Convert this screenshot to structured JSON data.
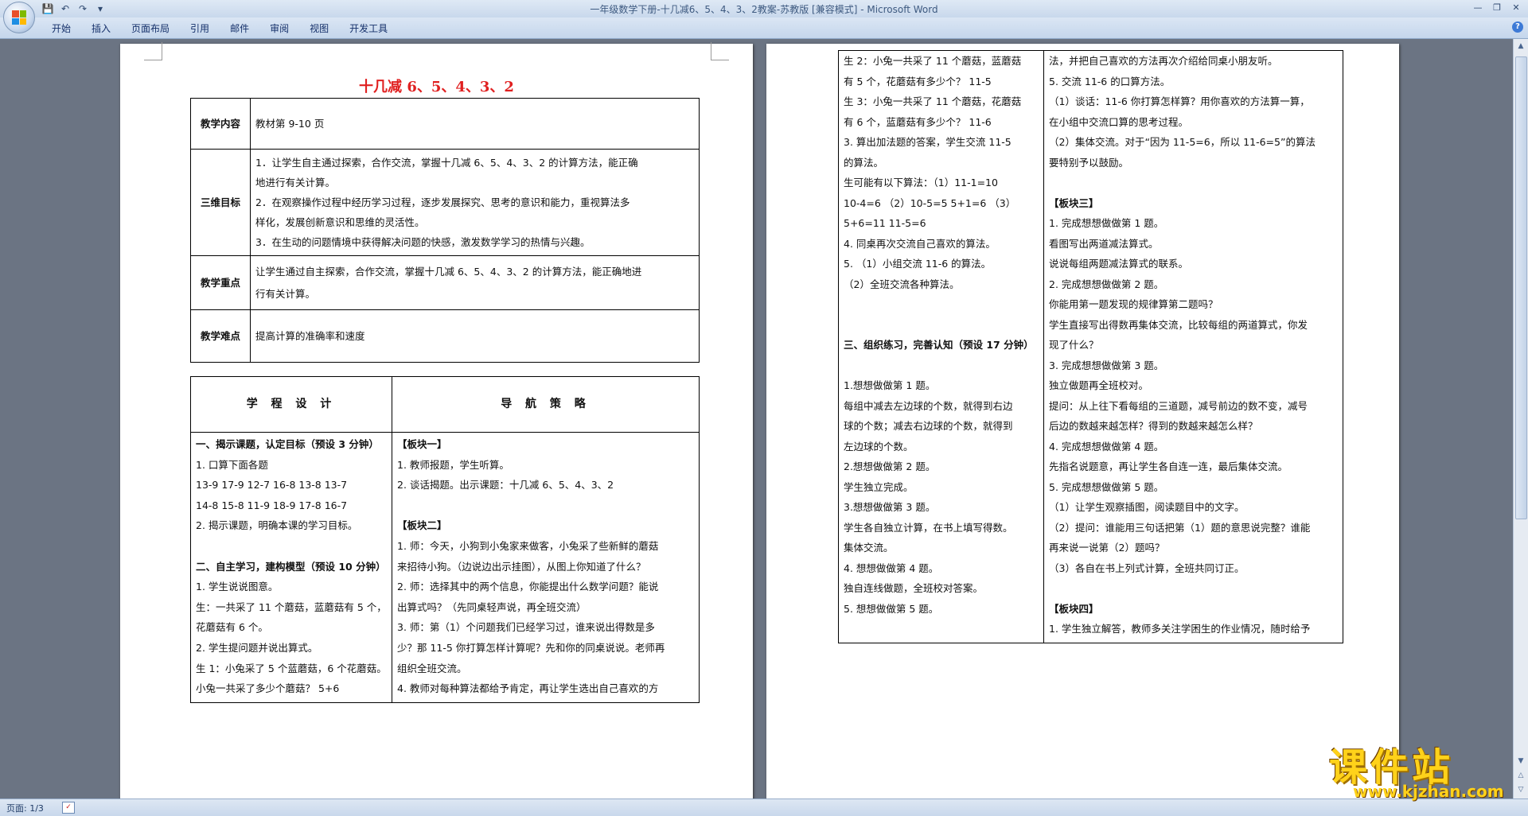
{
  "window": {
    "title": "一年级数学下册-十几减6、5、4、3、2教案-苏教版 [兼容模式] - Microsoft Word"
  },
  "ribbon_tabs": [
    "开始",
    "插入",
    "页面布局",
    "引用",
    "邮件",
    "审阅",
    "视图",
    "开发工具"
  ],
  "status": {
    "page": "页面: 1/3"
  },
  "logo": {
    "text": "课件站",
    "url": "www.kjzhan.com"
  },
  "page1": {
    "title": "十几减 6、5、4、3、2",
    "rows": [
      {
        "label": "教学内容",
        "content": [
          "教材第 9-10 页"
        ]
      },
      {
        "label": "三维目标",
        "content": [
          "1．让学生自主通过探索，合作交流，掌握十几减 6、5、4、3、2 的计算方法，能正确",
          "地进行有关计算。",
          "2．在观察操作过程中经历学习过程，逐步发展探究、思考的意识和能力，重视算法多",
          "样化，发展创新意识和思维的灵活性。",
          "3．在生动的问题情境中获得解决问题的快感，激发数学学习的热情与兴趣。"
        ]
      },
      {
        "label": "教学重点",
        "content": [
          "让学生通过自主探索，合作交流，掌握十几减 6、5、4、3、2 的计算方法，能正确地进",
          "行有关计算。"
        ]
      },
      {
        "label": "教学难点",
        "content": [
          "提高计算的准确率和速度"
        ]
      }
    ],
    "col_heads": [
      "学 程 设 计",
      "导 航 策 略"
    ],
    "left_lines": [
      "一、揭示课题，认定目标（预设 3 分钟）",
      "1. 口算下面各题",
      "13-9  17-9  12-7  16-8  13-8  13-7",
      "14-8  15-8  11-9  18-9  17-8  16-7",
      "2. 揭示课题，明确本课的学习目标。",
      "",
      "二、自主学习，建构模型（预设 10 分钟）",
      "1. 学生说说图意。",
      "生：一共采了 11 个蘑菇，蓝蘑菇有 5 个，",
      "花蘑菇有 6 个。",
      "2. 学生提问题并说出算式。",
      "生 1：小兔采了 5 个蓝蘑菇，6 个花蘑菇。",
      "小兔一共采了多少个蘑菇？  5+6"
    ],
    "right_lines": [
      "【板块一】",
      "1. 教师报题，学生听算。",
      "2. 谈话揭题。出示课题：十几减 6、5、4、3、2",
      "",
      "【板块二】",
      "1. 师：今天，小狗到小兔家来做客，小兔采了些新鲜的蘑菇",
      "来招待小狗。（边说边出示挂图），从图上你知道了什么？",
      "2. 师：选择其中的两个信息，你能提出什么数学问题？能说",
      "出算式吗？（先同桌轻声说，再全班交流）",
      "3. 师：第（1）个问题我们已经学习过，谁来说出得数是多",
      "少？那 11-5 你打算怎样计算呢？先和你的同桌说说。老师再",
      "组织全班交流。",
      "4. 教师对每种算法都给予肯定，再让学生选出自己喜欢的方"
    ]
  },
  "page2": {
    "left_lines": [
      "生 2：小兔一共采了 11 个蘑菇，蓝蘑菇",
      "有 5 个，花蘑菇有多少个？    11-5",
      "生 3：小兔一共采了 11 个蘑菇，花蘑菇",
      "有 6 个，蓝蘑菇有多少个？    11-6",
      "3. 算出加法题的答案，学生交流 11-5",
      "的算法。",
      "生可能有以下算法：（1）11-1=10",
      "10-4=6  （2）10-5=5  5+1=6   （3）",
      "5+6=11   11-5=6",
      "4. 同桌再次交流自己喜欢的算法。",
      "5. （1）小组交流 11-6 的算法。",
      "   （2）全班交流各种算法。",
      "",
      "",
      "三、组织练习，完善认知（预设 17 分钟）",
      "",
      "1.想想做做第 1 题。",
      "每组中减去左边球的个数，就得到右边",
      "球的个数；减去右边球的个数，就得到",
      "左边球的个数。",
      "2.想想做做第 2 题。",
      "学生独立完成。",
      "3.想想做做第 3 题。",
      "学生各自独立计算，在书上填写得数。",
      "集体交流。",
      "4. 想想做做第 4 题。",
      "独自连线做题，全班校对答案。",
      "5. 想想做做第 5 题。"
    ],
    "right_lines": [
      "法，并把自己喜欢的方法再次介绍给同桌小朋友听。",
      "5. 交流 11-6 的口算方法。",
      "（1）谈话：11-6 你打算怎样算？用你喜欢的方法算一算，",
      "在小组中交流口算的思考过程。",
      "（2）集体交流。对于“因为 11-5=6，所以 11-6=5”的算法",
      "要特别予以鼓励。",
      "",
      "【板块三】",
      "1. 完成想想做做第 1 题。",
      "看图写出两道减法算式。",
      "说说每组两题减法算式的联系。",
      "2. 完成想想做做第 2 题。",
      "你能用第一题发现的规律算第二题吗？",
      "学生直接写出得数再集体交流，比较每组的两道算式，你发",
      "现了什么？",
      "3. 完成想想做做第 3 题。",
      "独立做题再全班校对。",
      "提问：从上往下看每组的三道题，减号前边的数不变，减号",
      "后边的数越来越怎样？得到的数越来越怎么样？",
      "4. 完成想想做做第 4 题。",
      "先指名说题意，再让学生各自连一连，最后集体交流。",
      "5. 完成想想做做第 5 题。",
      "（1）让学生观察插图，阅读题目中的文字。",
      "（2）提问：谁能用三句话把第（1）题的意思说完整？谁能",
      "再来说一说第（2）题吗？",
      "（3）各自在书上列式计算，全班共同订正。",
      "",
      "【板块四】",
      "1. 学生独立解答，教师多关注学困生的作业情况，随时给予"
    ]
  }
}
